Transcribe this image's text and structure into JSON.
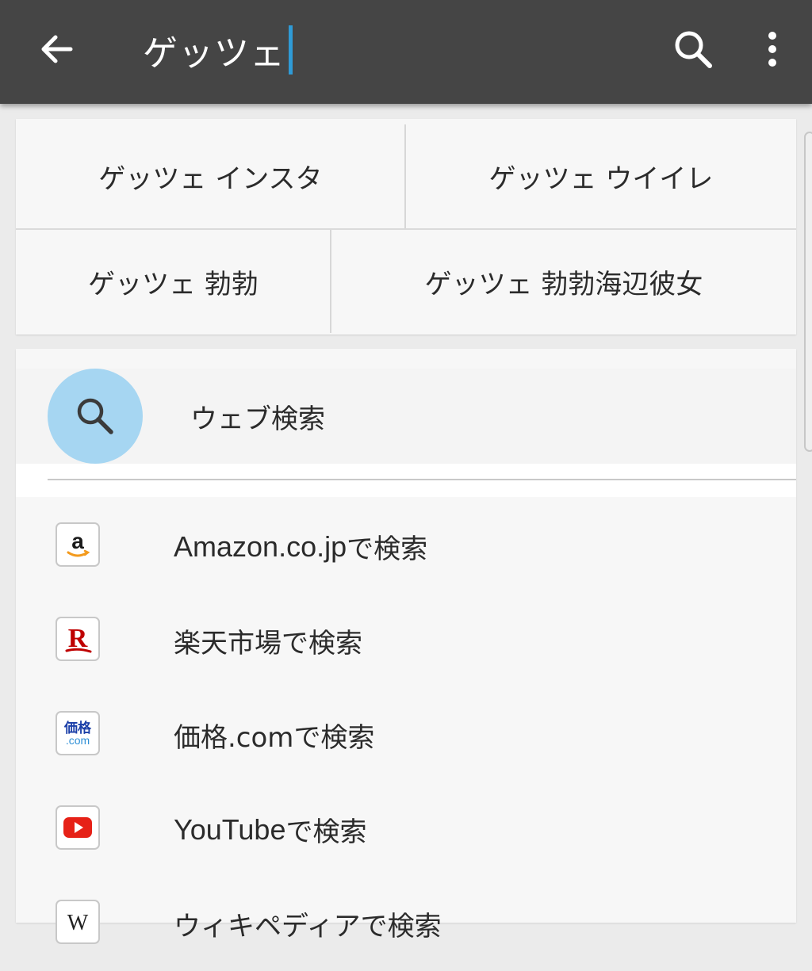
{
  "header": {
    "query": "ゲッツェ",
    "back_icon": "arrow-back-icon",
    "search_icon": "search-icon",
    "menu_icon": "more-vert-icon"
  },
  "suggestions": [
    {
      "label": "ゲッツェ インスタ"
    },
    {
      "label": "ゲッツェ ウイイレ"
    },
    {
      "label": "ゲッツェ 勃勃"
    },
    {
      "label": "ゲッツェ 勃勃海辺彼女"
    }
  ],
  "web_search": {
    "label": "ウェブ検索",
    "icon": "search-icon"
  },
  "engines": [
    {
      "name": "Amazon.co.jp",
      "suffix": " で検索",
      "icon": "amazon-icon",
      "icon_text": "a"
    },
    {
      "name": "楽天市場",
      "suffix": " で検索",
      "icon": "rakuten-icon",
      "icon_text": "R"
    },
    {
      "name": "価格.com",
      "suffix": " で検索",
      "icon": "kakaku-icon",
      "icon_text": "価格",
      "icon_subtext": ".com"
    },
    {
      "name": "YouTube",
      "suffix": " で検索",
      "icon": "youtube-icon",
      "icon_text": ""
    },
    {
      "name": "ウィキペディア",
      "suffix": " で検索",
      "icon": "wikipedia-icon",
      "icon_text": "W"
    }
  ],
  "colors": {
    "appbar": "#454545",
    "caret": "#2f9bd6",
    "web_circle": "#a6d6f2",
    "amazon_smile": "#f39a1d",
    "rakuten_red": "#bf0000",
    "youtube_red": "#e62117",
    "kakaku_blue": "#1b3fa8"
  }
}
